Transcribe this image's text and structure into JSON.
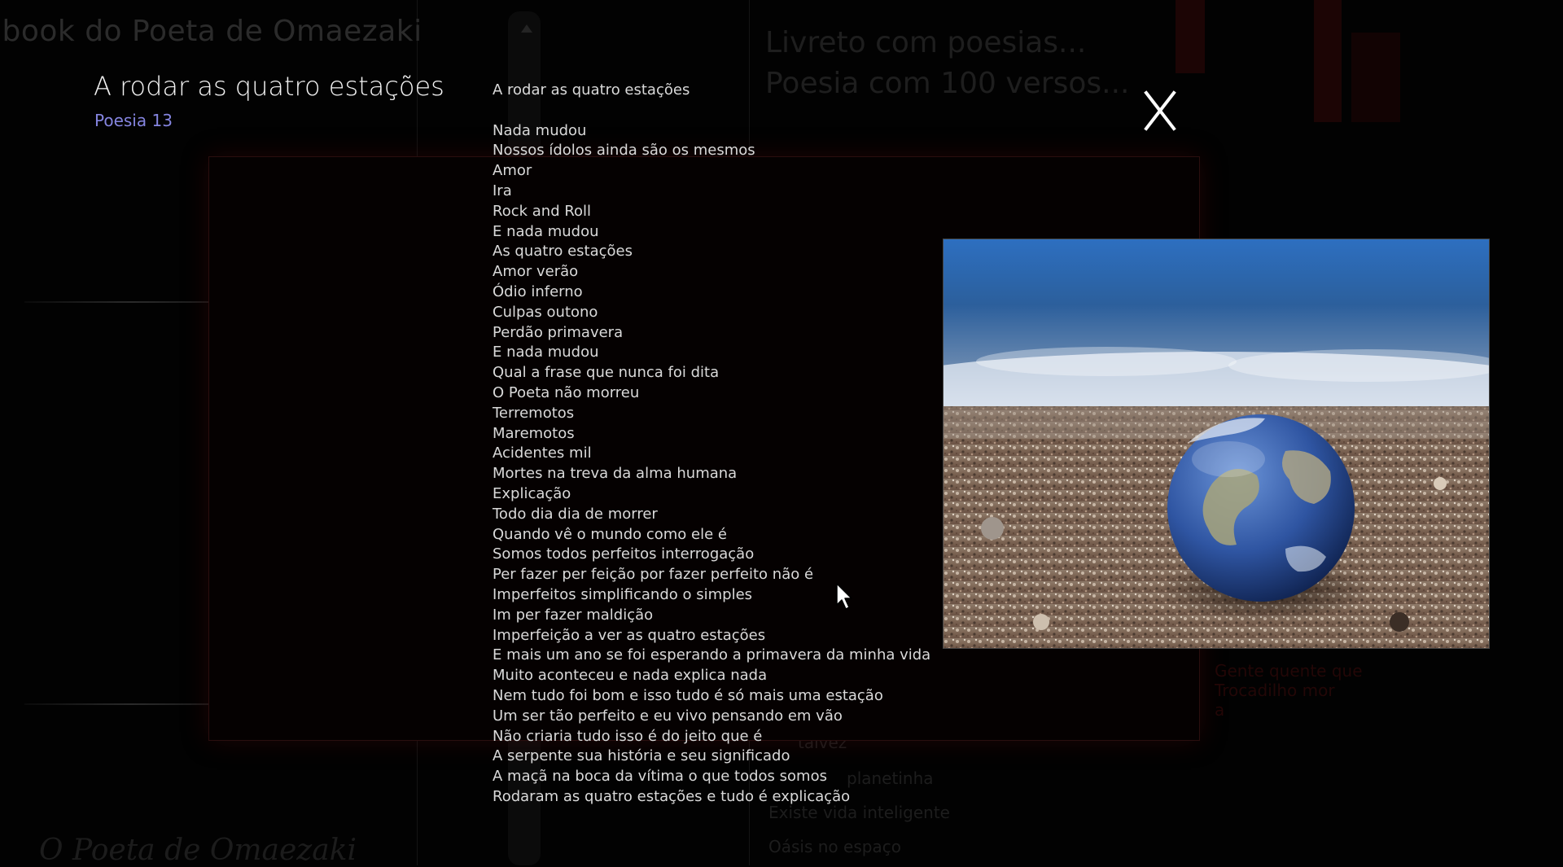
{
  "background": {
    "book_title": "ibook do Poeta de Omaezaki",
    "header_lines": [
      "Livreto com poesias...",
      "Poesia com 100 versos..."
    ],
    "footer_title": "O Poeta de Omaezaki",
    "nav_links": [
      "talvez",
      "planetinha",
      "Existe vida inteligente",
      "Oásis no espaço"
    ],
    "red_links": [
      "Gente quente que",
      "Trocadilho mor",
      "a"
    ]
  },
  "popup": {
    "title": "A rodar as quatro estações",
    "subtitle": "Poesia 13",
    "close_label": "X",
    "poem_heading": "A rodar as quatro estações",
    "poem_lines": [
      "Nada mudou",
      "Nossos ídolos ainda são os mesmos",
      "Amor",
      "Ira",
      "Rock and Roll",
      "E nada mudou",
      "As quatro estações",
      "Amor verão",
      "Ódio inferno",
      "Culpas outono",
      "Perdão primavera",
      "E nada mudou",
      "Qual a frase que nunca foi dita",
      "O Poeta não morreu",
      "Terremotos",
      "Maremotos",
      "Acidentes mil",
      "Mortes na treva da alma humana",
      "Explicação",
      "Todo dia dia de morrer",
      "Quando vê o mundo como ele é",
      "Somos todos perfeitos interrogação",
      "Per fazer per feição por fazer perfeito não é",
      "Imperfeitos simplificando o simples",
      "Im per fazer maldição",
      "Imperfeição a ver as quatro estações",
      "E mais um ano se foi esperando a primavera da minha vida",
      "Muito aconteceu e nada explica nada",
      "Nem tudo foi bom e isso tudo é só mais uma estação",
      "Um ser tão perfeito e eu vivo pensando em vão",
      "Não criaria tudo isso é do jeito que é",
      "A serpente sua história e seu significado",
      "A maçã na boca da vítima o que todos somos",
      "Rodaram as quatro estações e tudo é explicação"
    ]
  },
  "colors": {
    "background": "#020202",
    "poem_text": "#d9d9d9",
    "subtitle": "#8585e0",
    "popup_border": "#2a0e0e"
  }
}
